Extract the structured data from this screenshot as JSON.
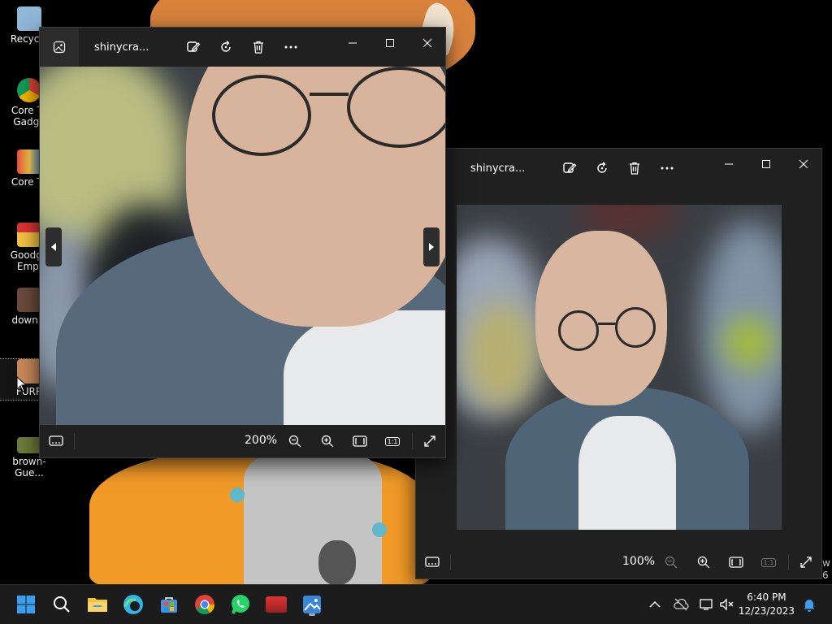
{
  "desktop": {
    "icons": [
      {
        "label": "Recycle"
      },
      {
        "label": "Core Te Gadge"
      },
      {
        "label": "Core Te"
      },
      {
        "label": "Goodga Empi"
      },
      {
        "label": "downlo"
      },
      {
        "label": "FURR"
      },
      {
        "label": "brown-Gue..."
      }
    ],
    "edge_text": [
      "w",
      "6"
    ]
  },
  "window1": {
    "title": "shinycra...",
    "zoom": "200%",
    "actual_size_label": "1:1"
  },
  "window2": {
    "title": "shinycra...",
    "zoom": "100%",
    "actual_size_label": "1:1"
  },
  "taskbar": {
    "time": "6:40 PM",
    "date": "12/23/2023"
  },
  "colors": {
    "window_bg": "#202020",
    "taskbar_bg": "#1c1c1c",
    "start_blue": "#3b9ef0",
    "edge_cyan": "#2fb4e8"
  }
}
